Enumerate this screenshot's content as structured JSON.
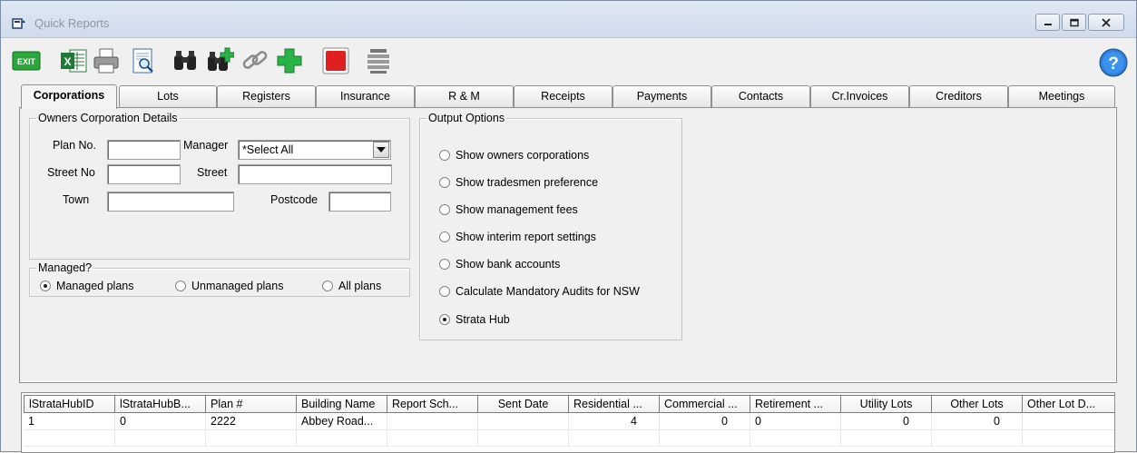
{
  "window": {
    "title": "Quick Reports"
  },
  "toolbar": {
    "exit_label": "EXIT",
    "buttons": [
      "exit-icon",
      "excel-icon",
      "print-icon",
      "preview-icon",
      "binoculars-icon",
      "find-next-icon",
      "link-icon",
      "add-icon",
      "stop-icon",
      "list-icon"
    ]
  },
  "tabs": [
    "Corporations",
    "Lots",
    "Registers",
    "Insurance",
    "R & M",
    "Receipts",
    "Payments",
    "Contacts",
    "Cr.Invoices",
    "Creditors",
    "Meetings"
  ],
  "owners": {
    "legend": "Owners Corporation Details",
    "plan_label": "Plan No.",
    "plan_value": "",
    "manager_label": "Manager",
    "manager_value": "*Select All",
    "street_no_label": "Street No",
    "street_no_value": "",
    "street_label": "Street",
    "street_value": "",
    "town_label": "Town",
    "town_value": "",
    "postcode_label": "Postcode",
    "postcode_value": ""
  },
  "managed": {
    "legend": "Managed?",
    "options": [
      "Managed plans",
      "Unmanaged plans",
      "All plans"
    ],
    "selected": "Managed plans"
  },
  "output": {
    "legend": "Output Options",
    "options": [
      "Show owners corporations",
      "Show tradesmen preference",
      "Show management fees",
      "Show interim report settings",
      "Show bank accounts",
      "Calculate Mandatory Audits for NSW",
      "Strata Hub"
    ],
    "selected": "Strata Hub"
  },
  "grid": {
    "columns": [
      "lStrataHubID",
      "lStrataHubB...",
      "Plan #",
      "Building Name",
      "Report Sch...",
      "Sent Date",
      "Residential ...",
      "Commercial ...",
      "Retirement ...",
      "Utility Lots",
      "Other Lots",
      "Other Lot D..."
    ],
    "rows": [
      [
        "1",
        "0",
        "2222",
        "Abbey Road...",
        "",
        "",
        "4",
        "0",
        "0",
        "0",
        "0",
        ""
      ]
    ]
  },
  "colors": {
    "titlebar": "#dfe8f3",
    "window_bg": "#f0f0f0",
    "exit_green": "#2aa63a",
    "stop_red": "#e02020"
  }
}
